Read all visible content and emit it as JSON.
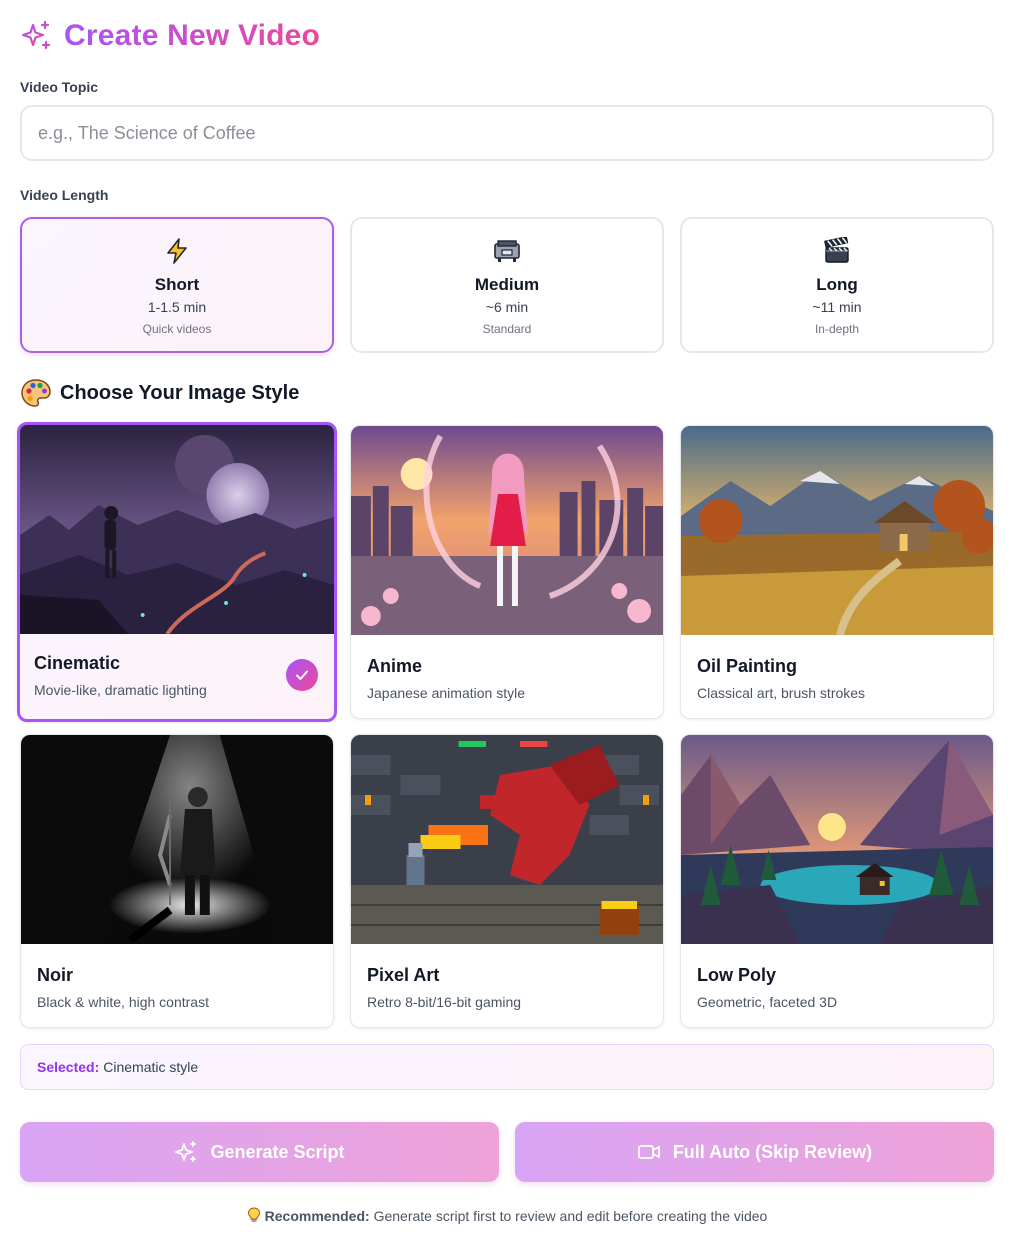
{
  "header": {
    "title": "Create New Video",
    "icon": "sparkles-icon"
  },
  "topic": {
    "label": "Video Topic",
    "placeholder": "e.g., The Science of Coffee",
    "value": ""
  },
  "length": {
    "label": "Video Length",
    "selected": "Short",
    "options": [
      {
        "name": "Short",
        "duration": "1-1.5 min",
        "subtitle": "Quick videos",
        "icon": "lightning-icon"
      },
      {
        "name": "Medium",
        "duration": "~6 min",
        "subtitle": "Standard",
        "icon": "film-projector-icon"
      },
      {
        "name": "Long",
        "duration": "~11 min",
        "subtitle": "In-depth",
        "icon": "clapperboard-icon"
      }
    ]
  },
  "styles": {
    "heading": "Choose Your Image Style",
    "heading_icon": "palette-icon",
    "items": [
      {
        "name": "Cinematic",
        "description": "Movie-like, dramatic lighting",
        "selected": true
      },
      {
        "name": "Anime",
        "description": "Japanese animation style"
      },
      {
        "name": "Oil Painting",
        "description": "Classical art, brush strokes"
      },
      {
        "name": "Noir",
        "description": "Black & white, high contrast"
      },
      {
        "name": "Pixel Art",
        "description": "Retro 8-bit/16-bit gaming"
      },
      {
        "name": "Low Poly",
        "description": "Geometric, faceted 3D"
      }
    ]
  },
  "selection": {
    "label": "Selected:",
    "value": "Cinematic style"
  },
  "actions": {
    "generate_label": "Generate Script",
    "auto_label": "Full Auto (Skip Review)"
  },
  "footer": {
    "icon": "lightbulb-icon",
    "label": "Recommended:",
    "text": "Generate script first to review and edit before creating the video"
  },
  "colors": {
    "accent_purple": "#a855f7",
    "accent_pink": "#ec4899",
    "selected_text": "#9333ea"
  }
}
